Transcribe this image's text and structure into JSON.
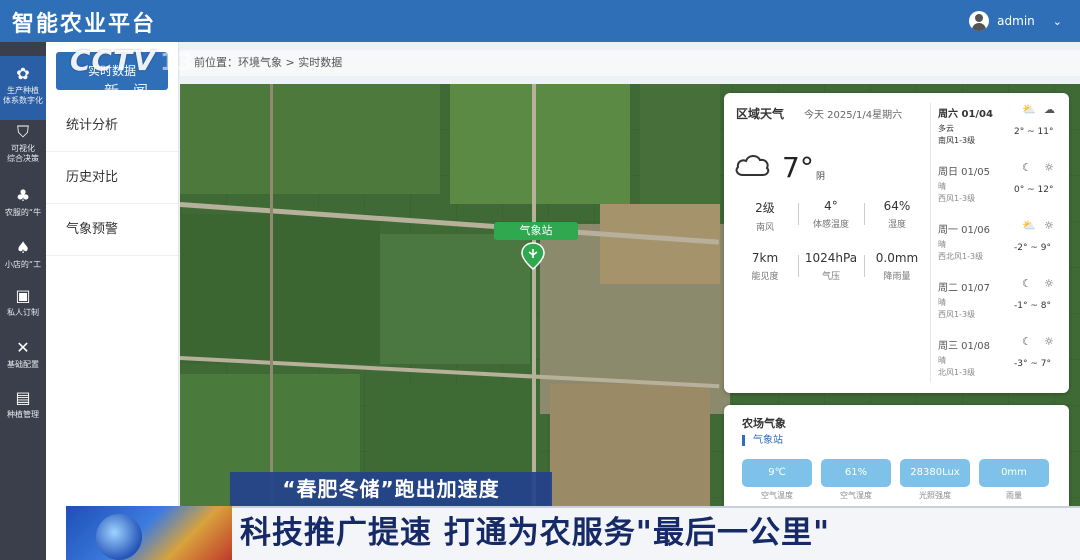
{
  "app": {
    "title": "智能农业平台",
    "user": "admin",
    "accent": "#2f6fb8"
  },
  "watermark": {
    "logo": "CCTV",
    "channel_number": "13",
    "channel_name": "新闻"
  },
  "rail": [
    {
      "label": "生产种植\n体系数字化",
      "icon": "seedling-icon",
      "active": true
    },
    {
      "label": "可视化\n综合决策",
      "icon": "shield-icon",
      "active": false
    },
    {
      "label": "农服的“牛",
      "icon": "wheat-icon",
      "active": false
    },
    {
      "label": "小店的“工",
      "icon": "grain-icon",
      "active": false
    },
    {
      "label": "私人订制",
      "icon": "screen-icon",
      "active": false
    },
    {
      "label": "基础配置",
      "icon": "tools-icon",
      "active": false
    },
    {
      "label": "种植管理",
      "icon": "document-icon",
      "active": false
    }
  ],
  "submenu": {
    "active": "实时数据",
    "items": [
      "统计分析",
      "历史对比",
      "气象预警"
    ]
  },
  "breadcrumb": "前位置：环境气象 > 实时数据",
  "map": {
    "station_label": "气象站"
  },
  "weather": {
    "title": "区域天气",
    "date": "今天 2025/1/4星期六",
    "now": {
      "icon": "cloud-icon",
      "temp": "7°",
      "cond": "阴"
    },
    "stats": [
      {
        "value": "2级",
        "label": "南风"
      },
      {
        "value": "4°",
        "label": "体感温度"
      },
      {
        "value": "64%",
        "label": "湿度"
      },
      {
        "value": "7km",
        "label": "能见度"
      },
      {
        "value": "1024hPa",
        "label": "气压"
      },
      {
        "value": "0.0mm",
        "label": "降雨量"
      }
    ],
    "forecast": [
      {
        "day": "周六  01/04",
        "cond": "多云",
        "wind": "南风1-3级",
        "range": "2° ~ 11°",
        "icons": [
          "cloud-sun-icon",
          "cloud-icon"
        ]
      },
      {
        "day": "周日  01/05",
        "cond": "晴",
        "wind": "西风1-3级",
        "range": "0° ~ 12°",
        "icons": [
          "moon-icon",
          "sun-icon"
        ]
      },
      {
        "day": "周一  01/06",
        "cond": "晴",
        "wind": "西北风1-3级",
        "range": "-2° ~ 9°",
        "icons": [
          "cloud-sun-icon",
          "sun-icon"
        ]
      },
      {
        "day": "周二  01/07",
        "cond": "晴",
        "wind": "西风1-3级",
        "range": "-1° ~ 8°",
        "icons": [
          "moon-icon",
          "sun-icon"
        ]
      },
      {
        "day": "周三  01/08",
        "cond": "晴",
        "wind": "北风1-3级",
        "range": "-3° ~ 7°",
        "icons": [
          "moon-icon",
          "sun-icon"
        ]
      }
    ]
  },
  "farm": {
    "title": "农场气象",
    "station": "气象站",
    "metrics": [
      {
        "value": "9℃",
        "label": "空气温度"
      },
      {
        "value": "61%",
        "label": "空气湿度"
      },
      {
        "value": "28380Lux",
        "label": "光照强度"
      },
      {
        "value": "0mm",
        "label": "雨量"
      }
    ]
  },
  "captions": {
    "top": "“春肥冬储”跑出加速度",
    "main": "科技推广提速 打通为农服务\"最后一公里\""
  }
}
